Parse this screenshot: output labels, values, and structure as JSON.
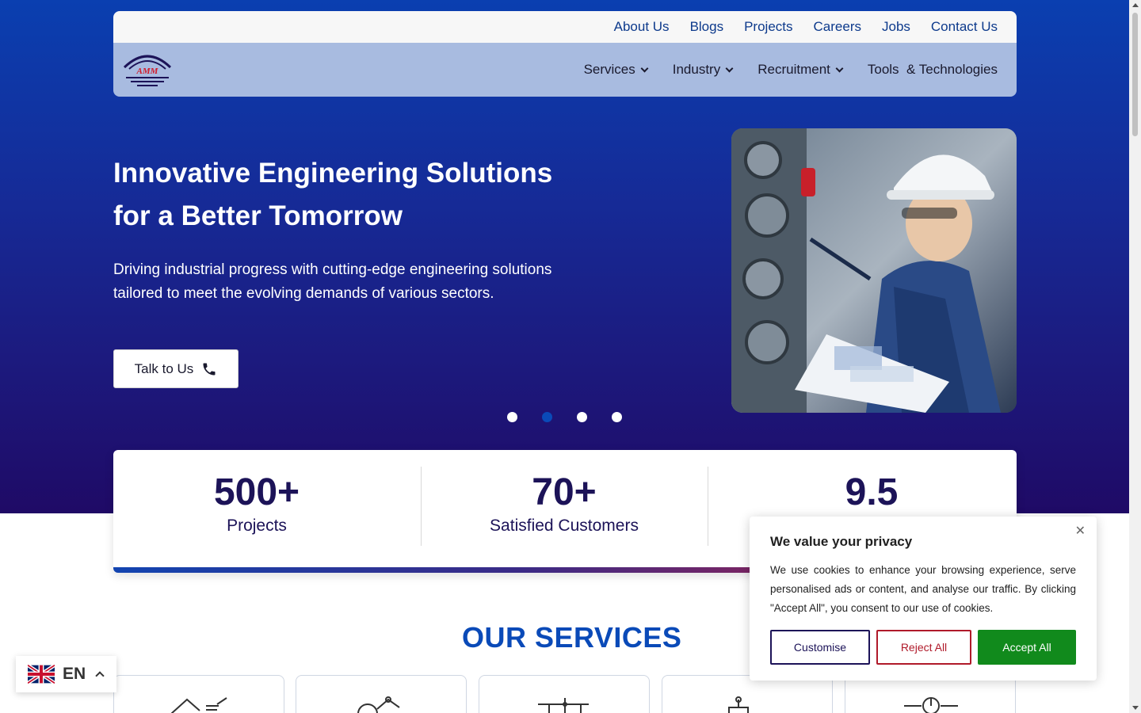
{
  "topnav": {
    "items": [
      "About Us",
      "Blogs",
      "Projects",
      "Careers",
      "Jobs",
      "Contact Us"
    ]
  },
  "logo": {
    "text": "AMM"
  },
  "mainnav": {
    "items": [
      {
        "label": "Services"
      },
      {
        "label": "Industry"
      },
      {
        "label": "Recruitment"
      },
      {
        "label": "Tools  & Technologies"
      }
    ]
  },
  "hero": {
    "title_line1": "Innovative Engineering Solutions",
    "title_line2": "for a Better Tomorrow",
    "subtitle": "Driving industrial progress with cutting-edge engineering solutions tailored to meet the evolving demands of various sectors.",
    "cta_label": "Talk to Us",
    "active_slide": 2,
    "slide_count": 4
  },
  "stats": [
    {
      "value": "500+",
      "label": "Projects"
    },
    {
      "value": "70+",
      "label": "Satisfied Customers"
    },
    {
      "value": "9.5",
      "label": ""
    }
  ],
  "services": {
    "title": "OUR SERVICES"
  },
  "language": {
    "code": "EN"
  },
  "cookie": {
    "title": "We value your privacy",
    "body": "We use cookies to enhance your browsing experience, serve personalised ads or content, and analyse our traffic. By clicking \"Accept All\", you consent to our use of cookies.",
    "customise": "Customise",
    "reject": "Reject All",
    "accept": "Accept All"
  },
  "colors": {
    "brand_blue": "#0a4ab8",
    "navy": "#1c1358",
    "accept_green": "#118a1c",
    "reject_red": "#b01a2a"
  }
}
